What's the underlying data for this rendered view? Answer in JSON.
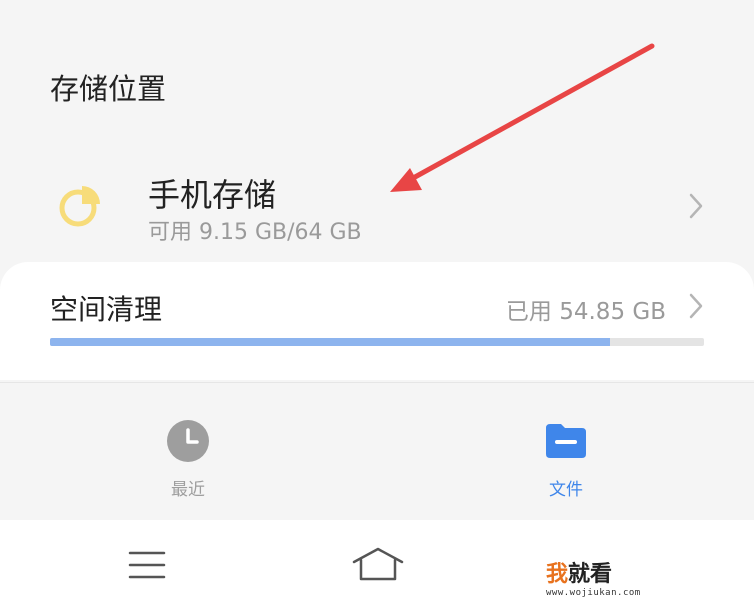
{
  "storage_section": {
    "title": "存储位置",
    "item": {
      "name": "手机存储",
      "available": "可用 9.15 GB/64 GB",
      "icon": "pie-chart-icon",
      "icon_color": "#f7dc7a"
    }
  },
  "cleanup": {
    "label": "空间清理",
    "used": "已用 54.85 GB",
    "used_fraction": 0.857,
    "bar_color": "#8db4ee"
  },
  "tabs": [
    {
      "label": "最近",
      "icon": "clock-icon",
      "color": "#9e9e9e",
      "selected": false
    },
    {
      "label": "文件",
      "icon": "folder-icon",
      "color": "#3f86ea",
      "selected": true
    }
  ],
  "annotation": {
    "arrow_color": "#e84545"
  },
  "watermark": {
    "text_first": "我",
    "text_rest": "就看",
    "url": "www.wojiukan.com"
  }
}
